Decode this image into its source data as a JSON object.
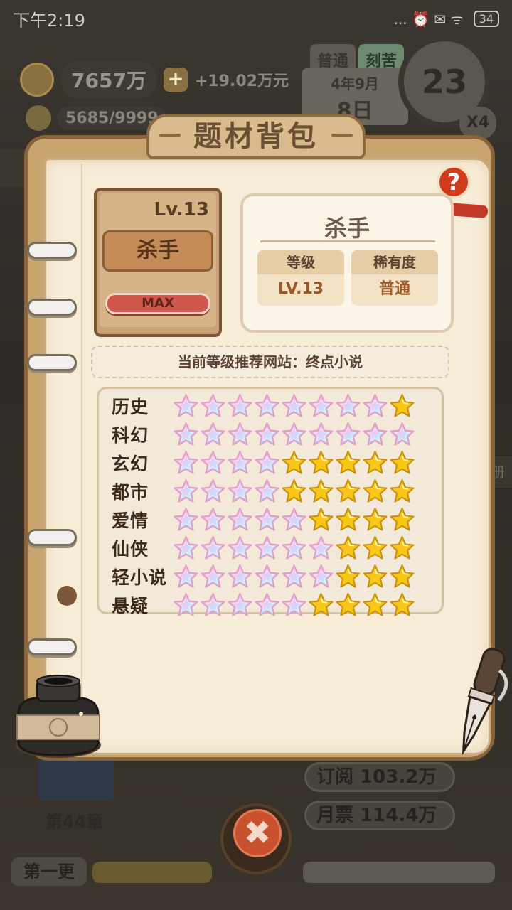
{
  "status_bar": {
    "time": "下午2:19",
    "icons": "... ⏰ ✉ ᯤ",
    "battery": "34"
  },
  "resources": {
    "money": "7657万",
    "plus": "+",
    "income": "+19.02万元",
    "energy": "5685/9999"
  },
  "mode_tabs": {
    "normal": "普通",
    "hard": "刻苦"
  },
  "date": {
    "year_month": "4年9月",
    "day": "8日"
  },
  "clock": {
    "value": "23",
    "speed": "X4"
  },
  "background": {
    "chapter": "第44章",
    "subscribe": "订阅 103.2万",
    "monthly_ticket": "月票 114.4万",
    "first_update": "第一更",
    "right_tab": "册"
  },
  "modal": {
    "title": "题材背包",
    "help": "?",
    "close": "✖",
    "item": {
      "level": "Lv.13",
      "name": "杀手",
      "badge": "MAX"
    },
    "info": {
      "name": "杀手",
      "level_label": "等级",
      "level_value": "LV.13",
      "rarity_label": "稀有度",
      "rarity_value": "普通"
    },
    "recommend": "当前等级推荐网站：终点小说",
    "genres": [
      {
        "name": "历史",
        "rainbow": 8,
        "gold": 1
      },
      {
        "name": "科幻",
        "rainbow": 9,
        "gold": 0
      },
      {
        "name": "玄幻",
        "rainbow": 4,
        "gold": 5
      },
      {
        "name": "都市",
        "rainbow": 4,
        "gold": 5
      },
      {
        "name": "爱情",
        "rainbow": 5,
        "gold": 4
      },
      {
        "name": "仙侠",
        "rainbow": 6,
        "gold": 3
      },
      {
        "name": "轻小说",
        "rainbow": 6,
        "gold": 3
      },
      {
        "name": "悬疑",
        "rainbow": 5,
        "gold": 4
      }
    ]
  },
  "colors": {
    "gold_star": "#f7c617",
    "rainbow_star": "#f2b6d8",
    "accent_red": "#d13a1a"
  }
}
